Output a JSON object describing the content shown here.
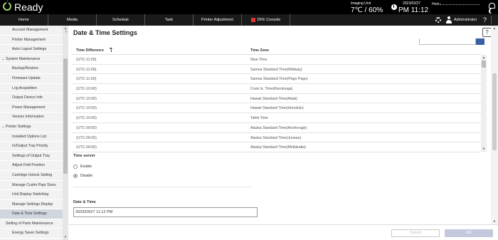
{
  "status": {
    "ready_label": "Ready",
    "imaging_unit_label": "Imaging Unit",
    "imaging_unit_value": "7℃ / 60%",
    "date": "2023/03/27",
    "time": "PM 11:12",
    "host_label": "Host :"
  },
  "nav": {
    "tabs": [
      "Home",
      "Media",
      "Schedule",
      "Task",
      "Printer Adjustment",
      "DFE Console"
    ],
    "user": "Administrator",
    "help": "?"
  },
  "sidebar": {
    "items": [
      {
        "label": "Account Management",
        "level": 2
      },
      {
        "label": "Printer Management",
        "level": 2
      },
      {
        "label": "Auto Logout Settings",
        "level": 2
      },
      {
        "label": "System Maintenance",
        "level": 1,
        "caret": "⌄"
      },
      {
        "label": "Backup/Restore",
        "level": 2
      },
      {
        "label": "Firmware Update",
        "level": 2
      },
      {
        "label": "Log Acquisition",
        "level": 2
      },
      {
        "label": "Output Device Info",
        "level": 2
      },
      {
        "label": "Power Management",
        "level": 2
      },
      {
        "label": "Version Information",
        "level": 2
      },
      {
        "label": "Printer Settings",
        "level": 1,
        "caret": "⌄"
      },
      {
        "label": "Installed Options List",
        "level": 2
      },
      {
        "label": "In/Output Tray Priority",
        "level": 2
      },
      {
        "label": "Settings of Output Tray",
        "level": 2
      },
      {
        "label": "Adjust Fold Position",
        "level": 2
      },
      {
        "label": "Cartridge Unlock Setting",
        "level": 2
      },
      {
        "label": "Manage Custm Papr Sizes",
        "level": 2
      },
      {
        "label": "Unit Display Switching",
        "level": 2
      },
      {
        "label": "Manage Settings Display",
        "level": 2
      },
      {
        "label": "Date & Time Settings",
        "level": 2,
        "selected": true
      },
      {
        "label": "Setting of Parts Maintenance",
        "level": 1
      },
      {
        "label": "Energy Saver Settings",
        "level": 2
      }
    ]
  },
  "page": {
    "title": "Date & Time Settings",
    "help": "?"
  },
  "timezone_table": {
    "headers": [
      "Time Difference",
      "Time Zone"
    ],
    "rows": [
      [
        "(UTC-11:00)",
        "Niue Time"
      ],
      [
        "(UTC-11:00)",
        "Samoa Standard Time(Midway)"
      ],
      [
        "(UTC-11:00)",
        "Samoa Standard Time(Pago Pago)"
      ],
      [
        "(UTC-10:00)",
        "Cook Is. Time(Rarotonga)"
      ],
      [
        "(UTC-10:00)",
        "Hawaii Standard Time(Adak)"
      ],
      [
        "(UTC-10:00)",
        "Hawaii Standard Time(Honolulu)"
      ],
      [
        "(UTC-10:00)",
        "Tahiti Time"
      ],
      [
        "(UTC-09:00)",
        "Alaska Standard Time(Anchorage)"
      ],
      [
        "(UTC-09:00)",
        "Alaska Standard Time(Juneau)"
      ],
      [
        "(UTC-09:00)",
        "Alaska Standard Time(Metlakatla)"
      ]
    ]
  },
  "time_server": {
    "label": "Time server",
    "options": [
      "Enable",
      "Disable"
    ],
    "selected": "Disable"
  },
  "date_time": {
    "label": "Date & Time",
    "value": "2023/03/27 11:12 PM"
  },
  "buttons": {
    "cancel": "Cancel",
    "ok": "OK"
  }
}
